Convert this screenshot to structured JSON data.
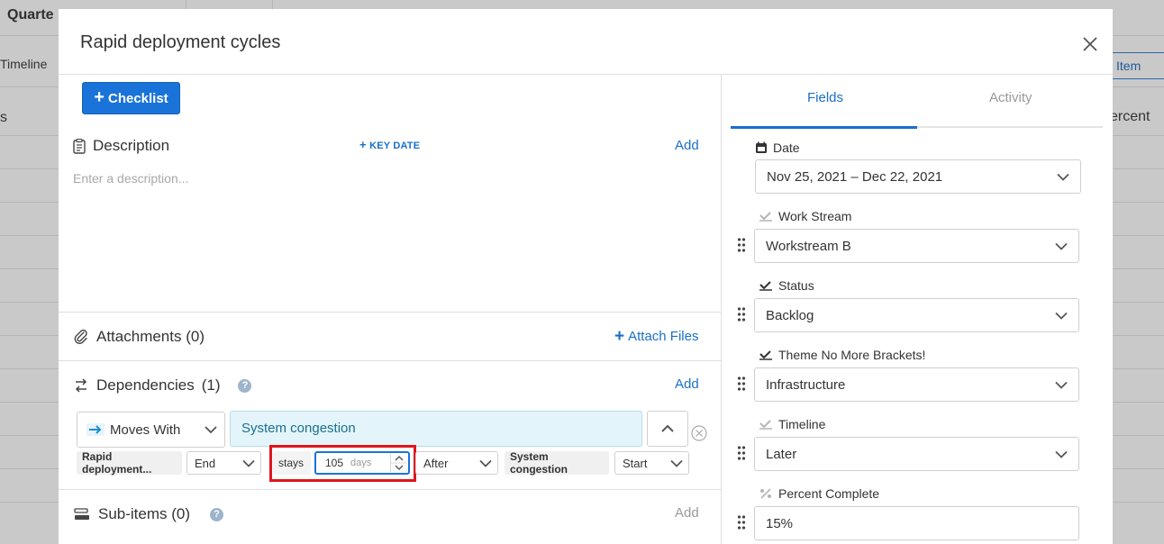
{
  "background": {
    "title": "Quarte",
    "tab": "Timeline",
    "col_fragment": "s",
    "item_button": "Item",
    "col_percent": "ercent"
  },
  "modal": {
    "title": "Rapid deployment cycles",
    "checklist_label": "Checklist",
    "description": {
      "title": "Description",
      "add_label": "Add",
      "placeholder": "Enter a description..."
    },
    "attachments": {
      "title": "Attachments (0)",
      "attach_label": "Attach Files"
    },
    "dependencies": {
      "title": "Dependencies",
      "count": "(1)",
      "add_label": "Add",
      "type": "Moves With",
      "target": "System congestion",
      "rule": {
        "source": "Rapid deployment...",
        "source_point": "End",
        "verb": "stays",
        "days_value": "105",
        "days_unit": "days",
        "relation": "After",
        "target": "System congestion",
        "target_point": "Start"
      }
    },
    "subitems": {
      "title": "Sub-items (0)",
      "add_label": "Add"
    }
  },
  "panel": {
    "tabs": [
      "Fields",
      "Activity"
    ],
    "key_date_label": "KEY DATE",
    "fields": [
      {
        "label": "Date",
        "value": "Nov 25, 2021 – Dec 22, 2021"
      },
      {
        "label": "Work Stream",
        "value": "Workstream B"
      },
      {
        "label": "Status",
        "value": "Backlog"
      },
      {
        "label": "Theme No More Brackets!",
        "value": "Infrastructure"
      },
      {
        "label": "Timeline",
        "value": "Later"
      },
      {
        "label": "Percent Complete",
        "value": "15%"
      }
    ]
  },
  "colors": {
    "accent": "#1a73d9",
    "highlight": "#e0161b",
    "dependency_bg": "#e3f5fb"
  }
}
